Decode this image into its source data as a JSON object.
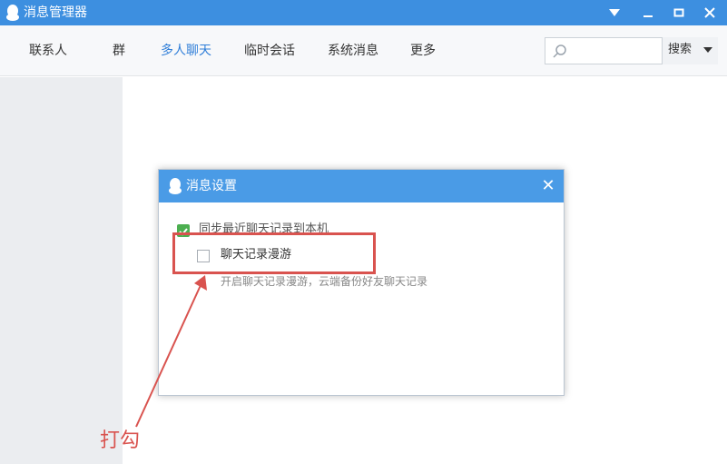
{
  "window": {
    "title": "消息管理器"
  },
  "nav": {
    "tabs": [
      {
        "label": "联系人",
        "active": false
      },
      {
        "label": "群",
        "active": false
      },
      {
        "label": "多人聊天",
        "active": true
      },
      {
        "label": "临时会话",
        "active": false
      },
      {
        "label": "系统消息",
        "active": false
      },
      {
        "label": "更多",
        "active": false
      }
    ],
    "search": {
      "placeholder": "",
      "button_label": "搜索"
    }
  },
  "dialog": {
    "title": "消息设置",
    "options": [
      {
        "label": "同步最近聊天记录到本机",
        "checked": true
      },
      {
        "label": "聊天记录漫游",
        "checked": false,
        "description": "开启聊天记录漫游，云端备份好友聊天记录"
      }
    ]
  },
  "annotation": {
    "text": "打勾"
  },
  "colors": {
    "titlebar": "#3d8fe0",
    "dialog_header": "#4a9be6",
    "active_tab": "#2f7ed8",
    "checked": "#4caf50",
    "annotation": "#d9534f"
  },
  "icons": {
    "app": "qq-penguin-icon",
    "search": "search-icon",
    "close": "close-icon"
  }
}
